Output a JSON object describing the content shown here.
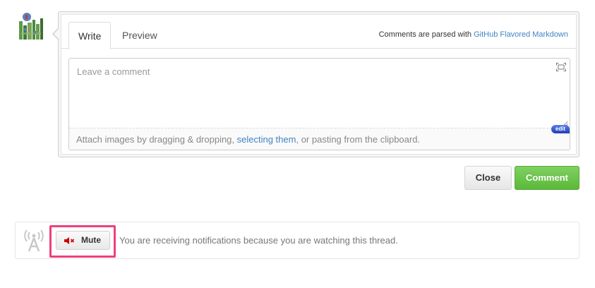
{
  "comment_form": {
    "tabs": [
      {
        "label": "Write"
      },
      {
        "label": "Preview"
      }
    ],
    "parsed_note_prefix": "Comments are parsed with ",
    "parsed_note_link": "GitHub Flavored Markdown",
    "textarea_placeholder": "Leave a comment",
    "textarea_value": "",
    "attach_prefix": "Attach images by dragging & dropping, ",
    "attach_link": "selecting them",
    "attach_suffix": ", or pasting from the clipboard.",
    "edit_badge": "edit"
  },
  "actions": {
    "close_label": "Close",
    "comment_label": "Comment"
  },
  "notifications": {
    "mute_label": "Mute",
    "message": "You are receiving notifications because you are watching this thread."
  },
  "colors": {
    "link": "#4183c4",
    "comment_button": "#6cc644",
    "highlight": "#ef3f7d",
    "mute_icon": "#cc0000"
  },
  "icons": {
    "avatar": "identicon-avatar",
    "fullscreen": "fullscreen-icon",
    "mute": "speaker-mute-icon",
    "broadcast": "broadcast-icon"
  }
}
